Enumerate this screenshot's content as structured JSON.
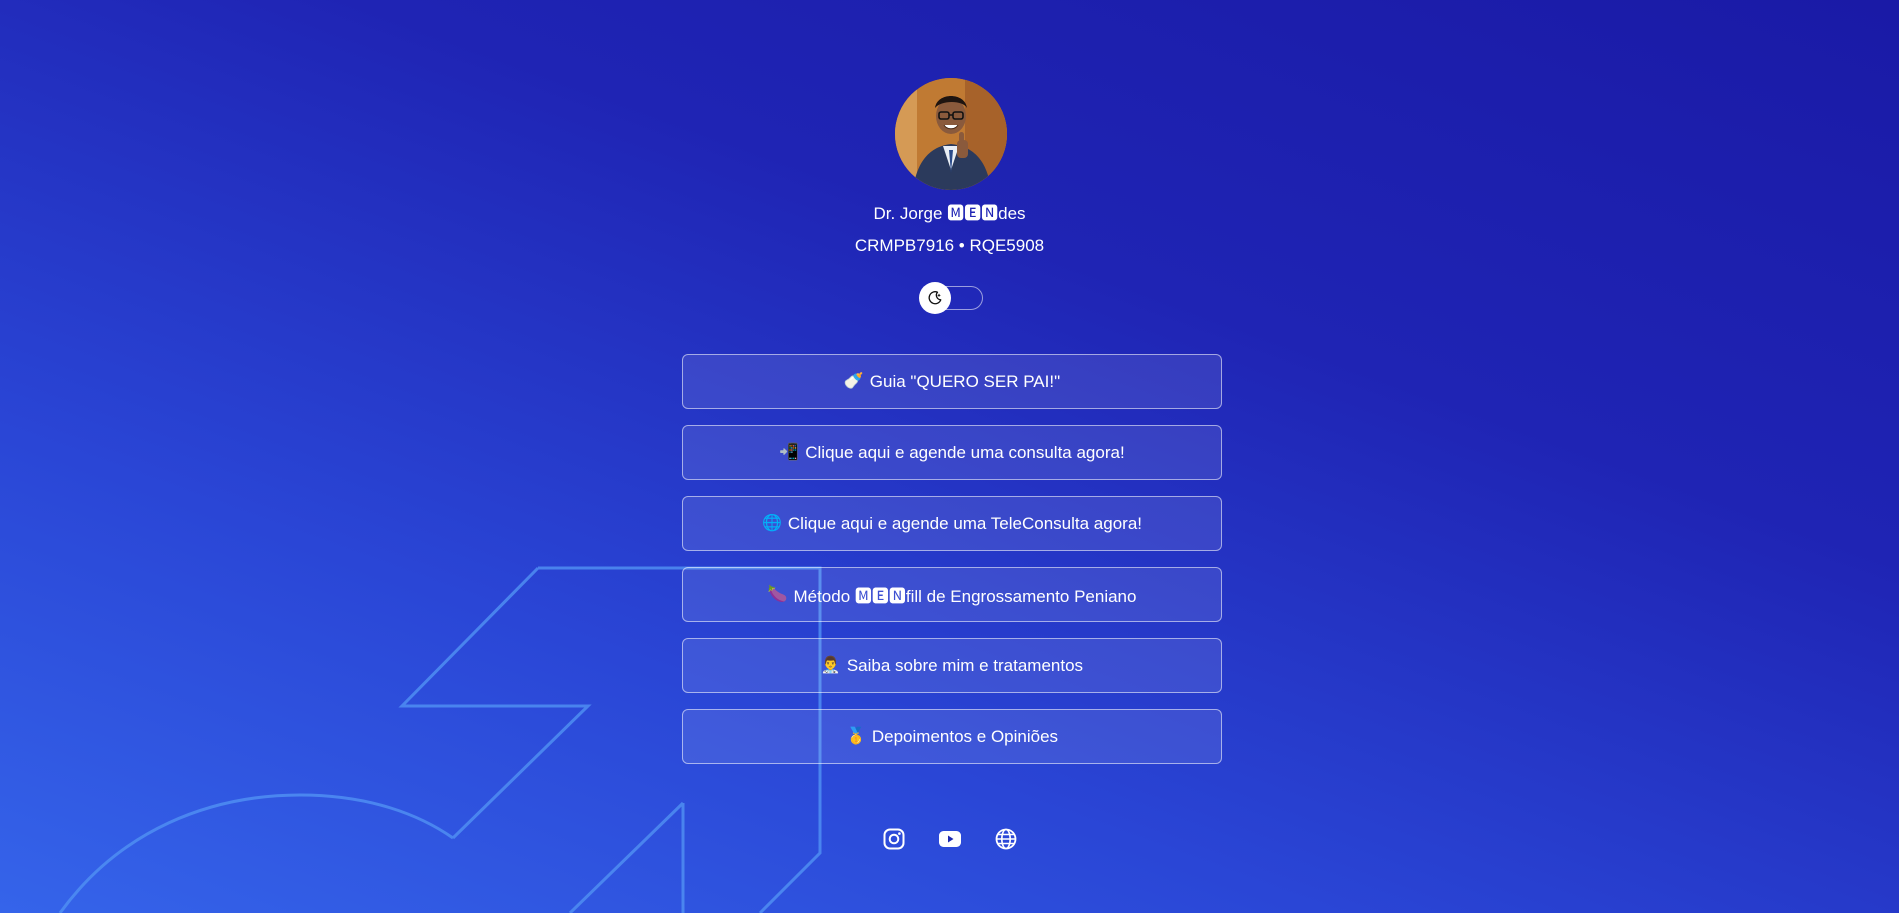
{
  "profile": {
    "name": "Dr. Jorge 🅼🅴🅽des",
    "credentials": "CRMPB7916 • RQE5908",
    "avatar": "doctor-profile-photo"
  },
  "theme_toggle": {
    "icon": "moon-icon",
    "state": "off"
  },
  "links": [
    {
      "emoji": "🍼",
      "label": "Guia \"QUERO SER PAI!\""
    },
    {
      "emoji": "📲",
      "label": "Clique aqui e agende uma consulta agora!"
    },
    {
      "emoji": "🌐",
      "label": "Clique aqui e agende uma TeleConsulta agora!"
    },
    {
      "emoji": "🍆",
      "label": "Método 🅼🅴🅽fill de Engrossamento Peniano"
    },
    {
      "emoji": "👨‍⚕️",
      "label": "Saiba sobre mim e tratamentos"
    },
    {
      "emoji": "🥇",
      "label": "Depoimentos e Opiniões"
    }
  ],
  "socials": [
    {
      "icon": "instagram-icon"
    },
    {
      "icon": "youtube-icon"
    },
    {
      "icon": "globe-icon"
    }
  ],
  "colors": {
    "background_start": "#1a1aa6",
    "background_end": "#3564ea",
    "art_stroke": "#4a86f0",
    "text": "#ffffff"
  }
}
